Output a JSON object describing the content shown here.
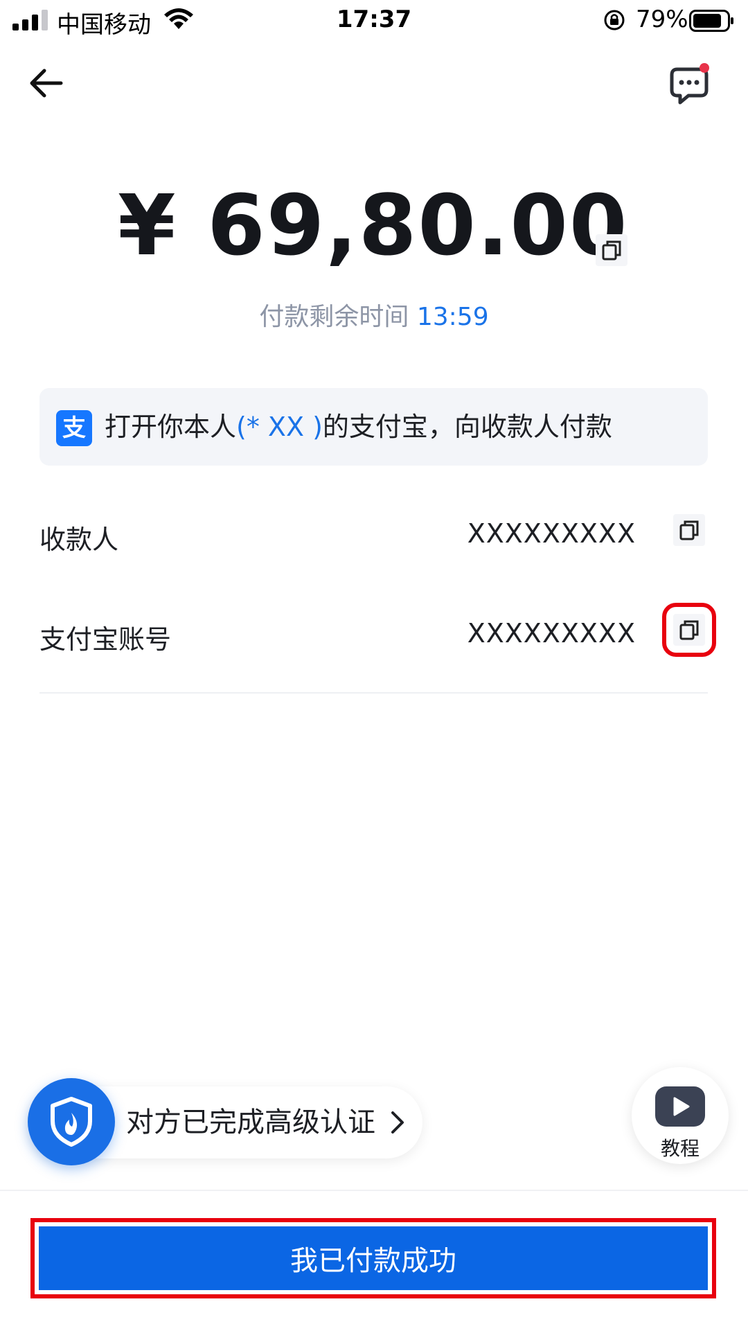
{
  "status_bar": {
    "carrier": "中国移动",
    "time": "17:37",
    "battery_percent": "79%"
  },
  "nav": {
    "back_icon": "arrow-left-icon",
    "chat_icon": "chat-bubble-icon"
  },
  "payment": {
    "amount": "¥ 69,80.00",
    "timer_label": "付款剩余时间",
    "timer_value": "13:59"
  },
  "notice": {
    "badge": "支",
    "text_before": "打开你本人",
    "highlight": "(* XX )",
    "text_after": "的支付宝，向收款人付款"
  },
  "rows": [
    {
      "label": "收款人",
      "value": "XXXXXXXXX"
    },
    {
      "label": "支付宝账号",
      "value": "XXXXXXXXX"
    }
  ],
  "verification": {
    "text": "对方已完成高级认证"
  },
  "tutorial": {
    "label": "教程"
  },
  "footer": {
    "pay_button": "我已付款成功"
  },
  "colors": {
    "primary": "#0b66e4",
    "highlight_blue": "#1a73e8",
    "alert_red": "#e8000e",
    "notification_dot": "#e8334a"
  }
}
